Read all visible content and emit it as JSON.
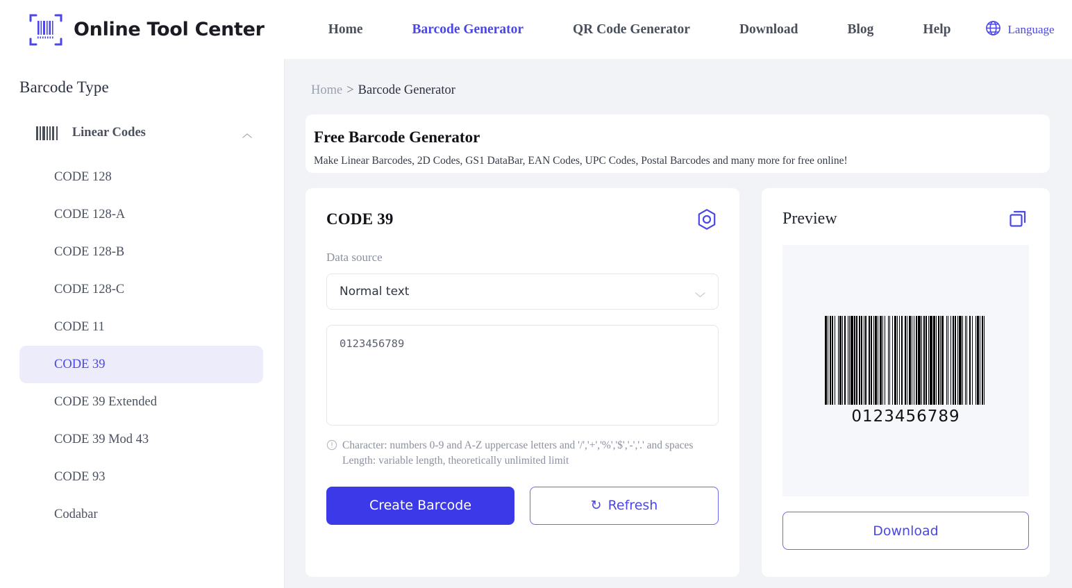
{
  "brand": {
    "name": "Online Tool Center",
    "logo_icon": "barcode-scan-icon"
  },
  "nav": {
    "items": [
      {
        "label": "Home",
        "active": false
      },
      {
        "label": "Barcode Generator",
        "active": true
      },
      {
        "label": "QR Code Generator",
        "active": false
      },
      {
        "label": "Download",
        "active": false
      },
      {
        "label": "Blog",
        "active": false
      },
      {
        "label": "Help",
        "active": false
      }
    ],
    "language": {
      "label": "Language",
      "icon": "globe-icon"
    }
  },
  "sidebar": {
    "title": "Barcode Type",
    "group": {
      "label": "Linear Codes",
      "icon": "barcode-icon",
      "chevron": "chevron-up-icon",
      "expanded": true
    },
    "items": [
      {
        "label": "CODE 128",
        "selected": false
      },
      {
        "label": "CODE 128-A",
        "selected": false
      },
      {
        "label": "CODE 128-B",
        "selected": false
      },
      {
        "label": "CODE 128-C",
        "selected": false
      },
      {
        "label": "CODE 11",
        "selected": false
      },
      {
        "label": "CODE 39",
        "selected": true
      },
      {
        "label": "CODE 39 Extended",
        "selected": false
      },
      {
        "label": "CODE 39 Mod 43",
        "selected": false
      },
      {
        "label": "CODE 93",
        "selected": false
      },
      {
        "label": "Codabar",
        "selected": false
      }
    ]
  },
  "breadcrumb": {
    "home": "Home",
    "separator": ">",
    "current": "Barcode Generator"
  },
  "hero": {
    "title": "Free Barcode Generator",
    "subtitle": "Make Linear Barcodes, 2D Codes, GS1 DataBar, EAN Codes, UPC Codes, Postal Barcodes and many more for free online!"
  },
  "generator": {
    "title": "CODE 39",
    "settings_icon": "settings-hexagon-icon",
    "data_source_label": "Data source",
    "data_source_value": "Normal text",
    "data_source_chevron": "chevron-down-icon",
    "input_value": "0123456789",
    "input_placeholder": "",
    "hint_icon": "info-circle-icon",
    "hint_line1": "Character: numbers 0-9 and A-Z uppercase letters and '/','+','%','$','-','.' and spaces",
    "hint_line2": "Length: variable length, theoretically unlimited limit",
    "create_label": "Create Barcode",
    "refresh_label": "Refresh",
    "refresh_icon": "refresh-icon"
  },
  "preview": {
    "title": "Preview",
    "copy_icon": "copy-icon",
    "barcode_text": "0123456789",
    "download_label": "Download"
  },
  "colors": {
    "accent": "#4a46e8",
    "primary_button": "#3c39e8",
    "selected_item_bg": "#ececfb",
    "page_bg": "#f2f3f7",
    "preview_bg": "#f5f7fb",
    "text_dark": "#2b3040",
    "text_muted": "#8b90a0"
  },
  "barcode_bars": [
    4,
    2,
    2,
    2,
    4,
    2,
    2,
    4,
    2,
    6,
    2,
    2,
    4,
    2,
    2,
    2,
    4,
    4,
    2,
    2,
    2,
    2,
    6,
    2,
    2,
    2,
    4,
    2,
    4,
    2,
    2,
    4,
    2,
    2,
    2,
    6,
    2,
    2,
    4,
    2,
    2,
    2,
    4,
    2,
    2,
    4,
    4,
    2,
    2,
    2,
    2,
    6,
    2,
    2,
    2,
    4,
    2,
    4,
    4,
    2,
    2,
    2,
    2,
    4,
    2,
    6,
    2,
    2,
    2,
    4,
    4,
    2,
    2,
    2,
    2,
    4,
    2,
    2,
    6,
    2,
    2,
    4,
    2,
    2,
    4,
    2,
    2,
    2,
    6,
    2,
    4,
    2,
    2,
    4,
    2,
    2,
    2,
    2,
    4,
    6,
    2,
    2,
    2,
    4,
    2,
    4,
    2,
    2,
    4,
    2,
    2,
    2,
    6,
    2,
    2,
    4,
    2,
    2,
    2,
    4,
    4,
    2,
    2,
    6,
    2,
    2,
    4,
    2,
    2,
    4,
    2,
    2,
    2,
    4
  ]
}
